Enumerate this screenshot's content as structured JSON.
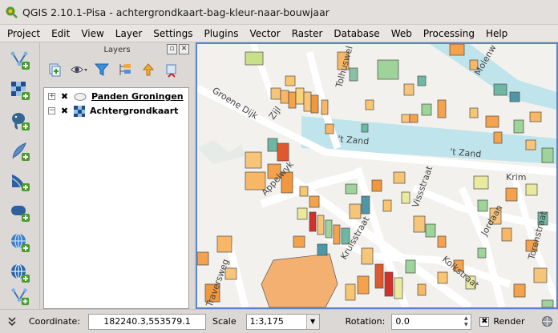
{
  "window": {
    "title": "QGIS 2.10.1-Pisa - achtergrondkaart-bag-kleur-naar-bouwjaar"
  },
  "menu": [
    "Project",
    "Edit",
    "View",
    "Layer",
    "Settings",
    "Plugins",
    "Vector",
    "Raster",
    "Database",
    "Web",
    "Processing",
    "Help"
  ],
  "layers_panel": {
    "title": "Layers",
    "float_btn": "▫",
    "close_btn": "✕",
    "layers": [
      {
        "name": "Panden Groningen",
        "checked": true,
        "expand": "+",
        "underline": true
      },
      {
        "name": "Achtergrondkaart",
        "checked": true,
        "expand": "−",
        "underline": false
      }
    ]
  },
  "map": {
    "labels": [
      "Groene Dijk",
      "Zijl",
      "Tolhuswel",
      "Molenw",
      "'t Zand",
      "'t Zand",
      "Appelwyk",
      "Vissstraat",
      "Krim",
      "Kruisstraat",
      "Kolkstraat",
      "Jordaan",
      "Torenstraat",
      "Traversweg"
    ],
    "colors": {
      "canal": "#bfe4ec",
      "road": "#ffffff",
      "ground": "#f2f1ee",
      "accent": "#5b84c8"
    }
  },
  "status": {
    "coordinate_label": "Coordinate:",
    "coordinate_value": "182240.3,553579.1",
    "scale_label": "Scale",
    "scale_value": "1:3,175",
    "rotation_label": "Rotation:",
    "rotation_value": "0.0",
    "render_label": "Render",
    "render_checked": "✖"
  }
}
